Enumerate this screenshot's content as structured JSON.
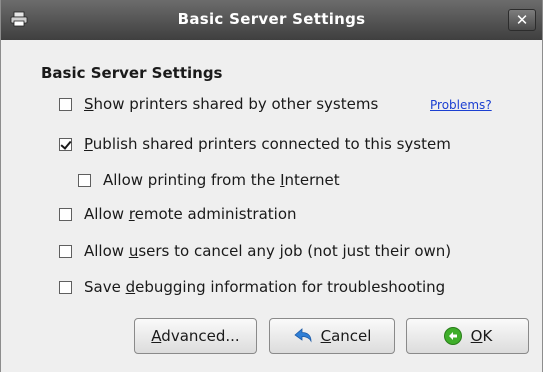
{
  "window": {
    "title": "Basic Server Settings",
    "close_glyph": "✕",
    "icon": "printer-icon"
  },
  "content": {
    "heading": "Basic Server Settings",
    "problems_link": "Problems?",
    "options": [
      {
        "pre": "",
        "key": "S",
        "post": "how printers shared by other systems",
        "checked": false
      },
      {
        "pre": "",
        "key": "P",
        "post": "ublish shared printers connected to this system",
        "checked": true
      },
      {
        "pre": "Allow printing from the ",
        "key": "I",
        "post": "nternet",
        "checked": false
      },
      {
        "pre": "Allow ",
        "key": "r",
        "post": "emote administration",
        "checked": false
      },
      {
        "pre": "Allow ",
        "key": "u",
        "post": "sers to cancel any job (not just their own)",
        "checked": false
      },
      {
        "pre": "Save ",
        "key": "d",
        "post": "ebugging information for troubleshooting",
        "checked": false
      }
    ]
  },
  "buttons": {
    "advanced": {
      "key": "A",
      "rest": "dvanced..."
    },
    "cancel": {
      "key": "C",
      "rest": "ancel",
      "icon": "undo-arrow-icon"
    },
    "ok": {
      "key": "O",
      "rest": "K",
      "icon": "green-ok-icon"
    }
  },
  "colors": {
    "titlebar": "#4f4f4f",
    "dialog_bg": "#efefef",
    "link": "#1b3fd1",
    "ok_icon": "#3fae2a",
    "cancel_icon": "#2f7fd6"
  }
}
